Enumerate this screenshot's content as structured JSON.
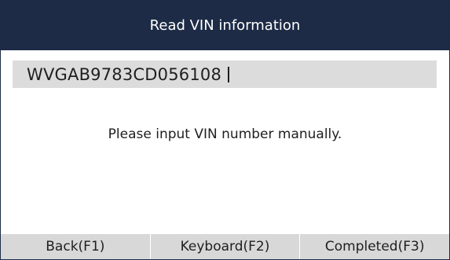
{
  "title": "Read VIN information",
  "vin_input": {
    "value": "WVGAB9783CD056108"
  },
  "message": "Please input VIN number manually.",
  "footer": {
    "back_label": "Back(F1)",
    "keyboard_label": "Keyboard(F2)",
    "completed_label": "Completed(F3)"
  },
  "colors": {
    "titlebar_bg": "#1d2b46",
    "field_bg": "#dcdcdc",
    "footer_bg": "#d8d8d8"
  }
}
